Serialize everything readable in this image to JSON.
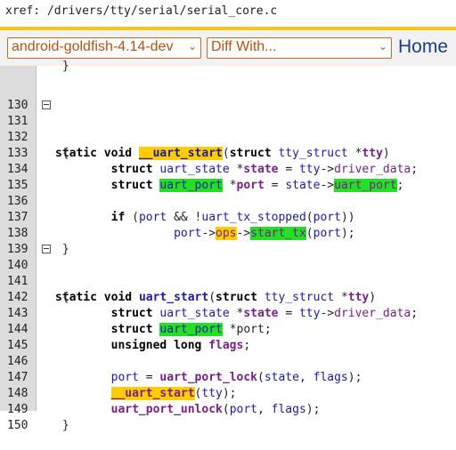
{
  "header": {
    "xref_path": "xref: /drivers/tty/serial/serial_core.c",
    "branch_select": "android-goldfish-4.14-dev",
    "diff_select": "Diff With...",
    "home_link": "Home"
  },
  "code": {
    "lines": [
      {
        "n": "130"
      },
      {
        "n": "131"
      },
      {
        "n": "132"
      },
      {
        "n": "133"
      },
      {
        "n": "134"
      },
      {
        "n": "135"
      },
      {
        "n": "136"
      },
      {
        "n": "137"
      },
      {
        "n": "138"
      },
      {
        "n": "139"
      },
      {
        "n": "140"
      },
      {
        "n": "141"
      },
      {
        "n": "142"
      },
      {
        "n": "143"
      },
      {
        "n": "144"
      },
      {
        "n": "145"
      },
      {
        "n": "146"
      },
      {
        "n": "147"
      },
      {
        "n": "148"
      },
      {
        "n": "149"
      },
      {
        "n": "150"
      }
    ],
    "tokens": {
      "static": "static",
      "void": "void",
      "struct": "struct",
      "if": "if",
      "unsigned_long": "unsigned long",
      "fn_uart_start_hl": "__uart_start",
      "fn_uart_start": "uart_start",
      "tty_struct": "tty_struct",
      "tty": "tty",
      "uart_state": "uart_state",
      "state": "state",
      "uart_port": "uart_port",
      "port": "port",
      "driver_data": "driver_data",
      "flags": "flags",
      "uart_tx_stopped": "uart_tx_stopped",
      "ops": "ops",
      "start_tx": "start_tx",
      "uart_port_lock": "uart_port_lock",
      "uart_port_unlock": "uart_port_unlock"
    }
  }
}
